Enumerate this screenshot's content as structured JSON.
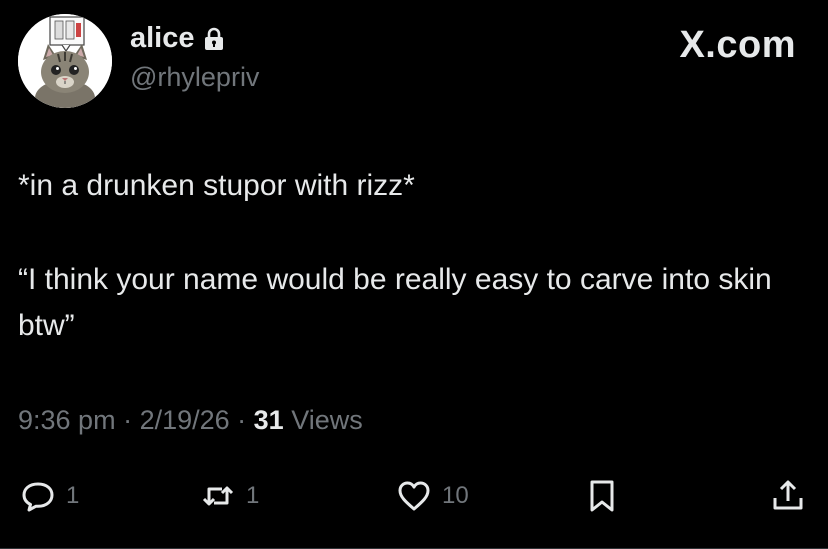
{
  "header": {
    "display_name": "alice",
    "handle": "@rhylepriv",
    "brand": "X.com"
  },
  "tweet": {
    "line1": "*in a drunken stupor with rizz*",
    "line2": "“I think your name would be really easy to carve into skin btw”"
  },
  "meta": {
    "time": "9:36 pm",
    "sep1": " · ",
    "date": "2/19/26",
    "sep2": " · ",
    "views_count": "31",
    "views_label": " Views"
  },
  "actions": {
    "replies": "1",
    "reposts": "1",
    "likes": "10"
  },
  "icons": {
    "avatar": "cat-avatar-icon",
    "lock": "lock-icon",
    "reply": "reply-icon",
    "repost": "repost-icon",
    "like": "heart-icon",
    "bookmark": "bookmark-icon",
    "share": "share-icon"
  },
  "colors": {
    "background": "#000000",
    "text": "#e7e9ea",
    "secondary": "#71767b"
  }
}
